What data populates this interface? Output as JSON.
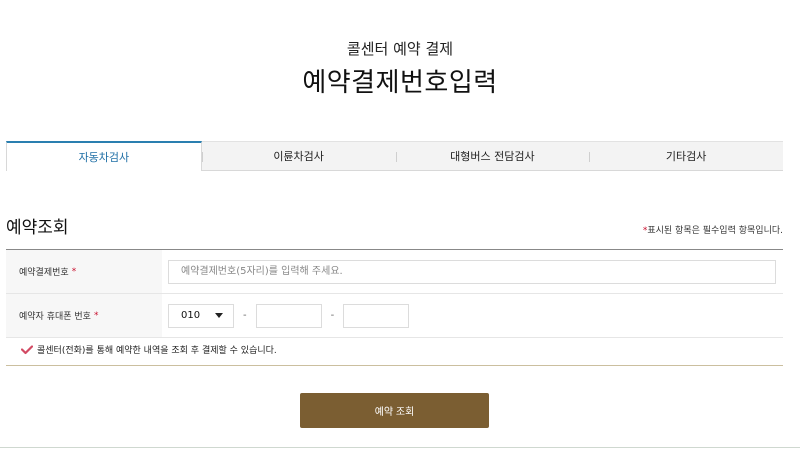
{
  "header": {
    "subtitle": "콜센터 예약 결제",
    "title": "예약결제번호입력"
  },
  "tabs": [
    {
      "label": "자동차검사",
      "active": true
    },
    {
      "label": "이륜차검사",
      "active": false
    },
    {
      "label": "대형버스 전담검사",
      "active": false
    },
    {
      "label": "기타검사",
      "active": false
    }
  ],
  "section": {
    "title": "예약조회",
    "required_star": "*",
    "required_note": "표시된 항목은 필수입력 항목입니다."
  },
  "form": {
    "reservation_label": "예약결제번호",
    "reservation_placeholder": "예약결제번호(5자리)를 입력해 주세요.",
    "phone_label": "예약자 휴대폰 번호",
    "required_star": "*",
    "phone_prefix": "010",
    "dash": "-"
  },
  "notice": "콜센터(전화)를 통해 예약한 내역을 조회 후 결제할 수 있습니다.",
  "submit_label": "예약 조회",
  "colors": {
    "accent": "#2a7fb0",
    "button": "#7b5e32",
    "required": "#c8102e",
    "check": "#d24a63"
  }
}
